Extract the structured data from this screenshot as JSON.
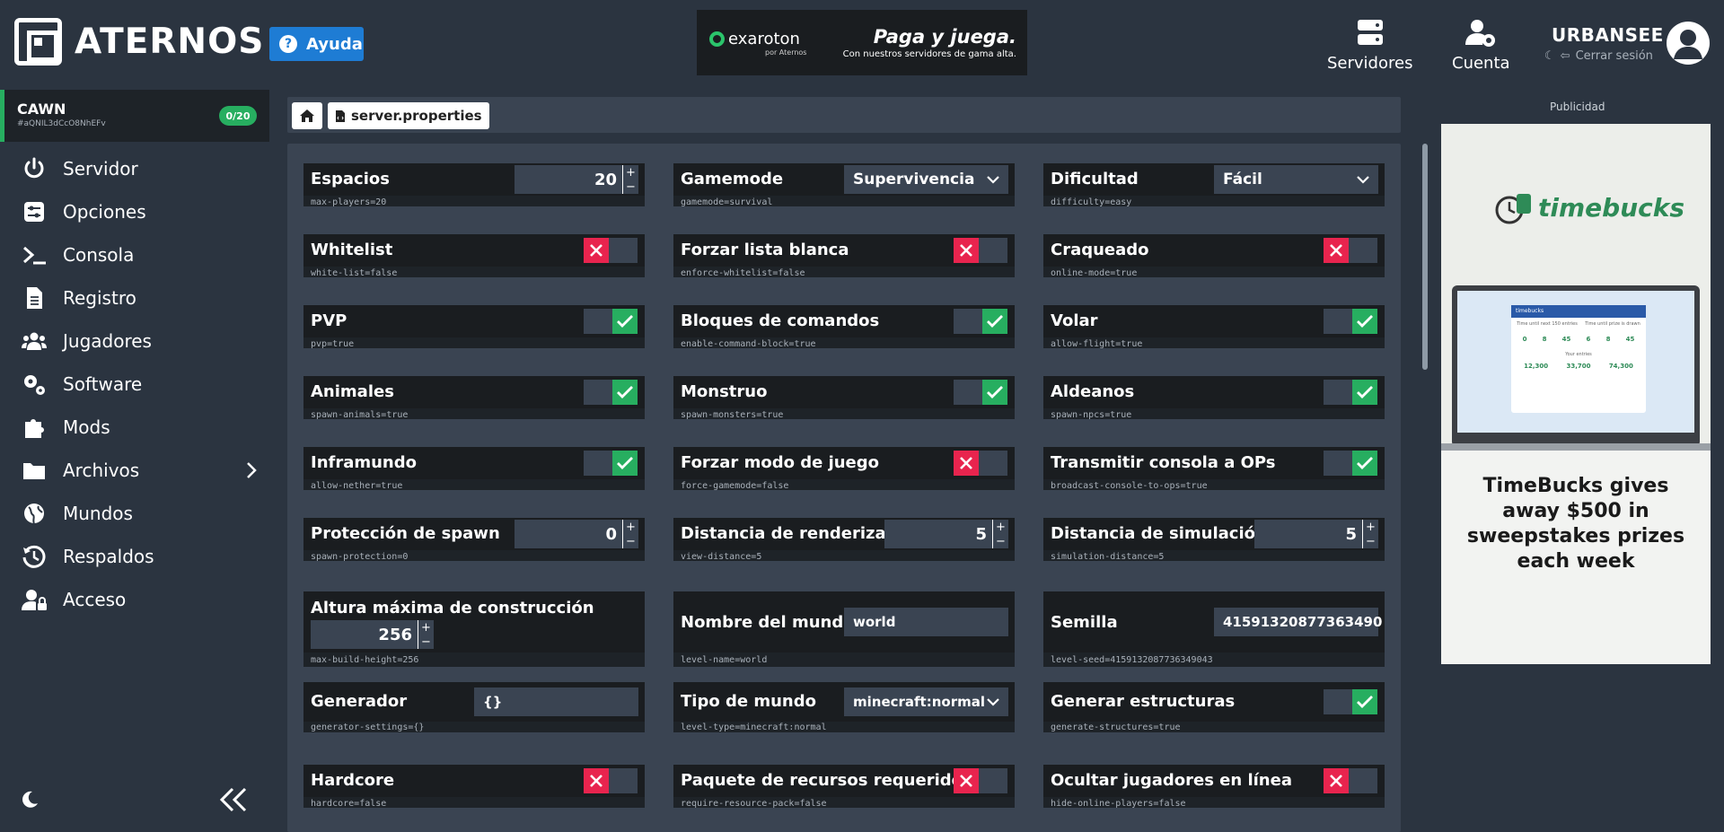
{
  "header": {
    "logo_text": "ATERNOS",
    "help_label": "Ayuda",
    "banner": {
      "brand": "exaroton",
      "by": "por Aternos",
      "title": "Paga y juega.",
      "subtitle": "Con nuestros servidores de gama alta."
    },
    "nav": {
      "servers": "Servidores",
      "account": "Cuenta"
    },
    "user": {
      "name": "URBANSEE",
      "logout": "Cerrar sesión"
    }
  },
  "sidebar": {
    "server_name": "CAWN",
    "server_id": "#aQNIL3dCcO8NhEFv",
    "players": "0/20",
    "items": [
      {
        "label": "Servidor",
        "icon": "power-icon"
      },
      {
        "label": "Opciones",
        "icon": "sliders-icon"
      },
      {
        "label": "Consola",
        "icon": "terminal-icon"
      },
      {
        "label": "Registro",
        "icon": "document-icon"
      },
      {
        "label": "Jugadores",
        "icon": "users-icon"
      },
      {
        "label": "Software",
        "icon": "gears-icon"
      },
      {
        "label": "Mods",
        "icon": "puzzle-icon"
      },
      {
        "label": "Archivos",
        "icon": "folder-icon"
      },
      {
        "label": "Mundos",
        "icon": "globe-icon"
      },
      {
        "label": "Respaldos",
        "icon": "history-icon"
      },
      {
        "label": "Acceso",
        "icon": "user-lock-icon"
      }
    ]
  },
  "breadcrumb": {
    "file": "server.properties"
  },
  "options": {
    "max_players": {
      "label": "Espacios",
      "value": "20",
      "key": "max-players",
      "keyval": "20"
    },
    "gamemode": {
      "label": "Gamemode",
      "value": "Supervivencia",
      "key": "gamemode",
      "keyval": "survival"
    },
    "difficulty": {
      "label": "Dificultad",
      "value": "Fácil",
      "key": "difficulty",
      "keyval": "easy"
    },
    "whitelist": {
      "label": "Whitelist",
      "key": "white-list",
      "keyval": "false"
    },
    "enforce_whitelist": {
      "label": "Forzar lista blanca",
      "key": "enforce-whitelist",
      "keyval": "false"
    },
    "cracked": {
      "label": "Craqueado",
      "key": "online-mode",
      "keyval": "true"
    },
    "pvp": {
      "label": "PVP",
      "key": "pvp",
      "keyval": "true"
    },
    "command_blocks": {
      "label": "Bloques de comandos",
      "key": "enable-command-block",
      "keyval": "true"
    },
    "flight": {
      "label": "Volar",
      "key": "allow-flight",
      "keyval": "true"
    },
    "animals": {
      "label": "Animales",
      "key": "spawn-animals",
      "keyval": "true"
    },
    "monsters": {
      "label": "Monstruo",
      "key": "spawn-monsters",
      "keyval": "true"
    },
    "villagers": {
      "label": "Aldeanos",
      "key": "spawn-npcs",
      "keyval": "true"
    },
    "nether": {
      "label": "Inframundo",
      "key": "allow-nether",
      "keyval": "true"
    },
    "force_gamemode": {
      "label": "Forzar modo de juego",
      "key": "force-gamemode",
      "keyval": "false"
    },
    "broadcast": {
      "label": "Transmitir consola a OPs",
      "key": "broadcast-console-to-ops",
      "keyval": "true"
    },
    "spawn_protection": {
      "label": "Protección de spawn",
      "value": "0",
      "key": "spawn-protection",
      "keyval": "0"
    },
    "view_distance": {
      "label": "Distancia de renderizado",
      "value": "5",
      "key": "view-distance",
      "keyval": "5"
    },
    "sim_distance": {
      "label": "Distancia de simulación",
      "value": "5",
      "key": "simulation-distance",
      "keyval": "5"
    },
    "build_height": {
      "label": "Altura máxima de construcción",
      "value": "256",
      "key": "max-build-height",
      "keyval": "256"
    },
    "level_name": {
      "label": "Nombre del mundo",
      "value": "world",
      "key": "level-name",
      "keyval": "world"
    },
    "seed": {
      "label": "Semilla",
      "value": "41591320877363490",
      "key": "level-seed",
      "keyval": "4159132087736349043"
    },
    "generator": {
      "label": "Generador",
      "value": "{}",
      "key": "generator-settings",
      "keyval": "{}"
    },
    "level_type": {
      "label": "Tipo de mundo",
      "value": "minecraft:normal",
      "key": "level-type",
      "keyval": "minecraft:normal"
    },
    "structures": {
      "label": "Generar estructuras",
      "key": "generate-structures",
      "keyval": "true"
    },
    "hardcore": {
      "label": "Hardcore",
      "key": "hardcore",
      "keyval": "false"
    },
    "resource_pack": {
      "label": "Paquete de recursos requerido",
      "key": "require-resource-pack",
      "keyval": "false"
    },
    "hide_players": {
      "label": "Ocultar jugadores en línea",
      "key": "hide-online-players",
      "keyval": "false"
    }
  },
  "stepper": {
    "plus": "+",
    "minus": "−"
  },
  "ad": {
    "label": "Publicidad",
    "brand": "timebucks",
    "headline": "TimeBucks gives away $500 in sweepstakes prizes each week",
    "screen": {
      "title": "timebucks",
      "col1": "Time until next 150 entries",
      "col2": "Time until prize is drawn",
      "n1": "0",
      "n2": "8",
      "n3": "45",
      "n4": "6",
      "n5": "8",
      "n6": "45",
      "entries": "Your entries",
      "today": "12,300",
      "yesterday": "33,700",
      "week": "74,300"
    }
  },
  "colors": {
    "bg": "#2b3440",
    "card": "#1e2328",
    "accent": "#27ae60",
    "danger": "#e8244e",
    "help": "#1e7cd4"
  }
}
